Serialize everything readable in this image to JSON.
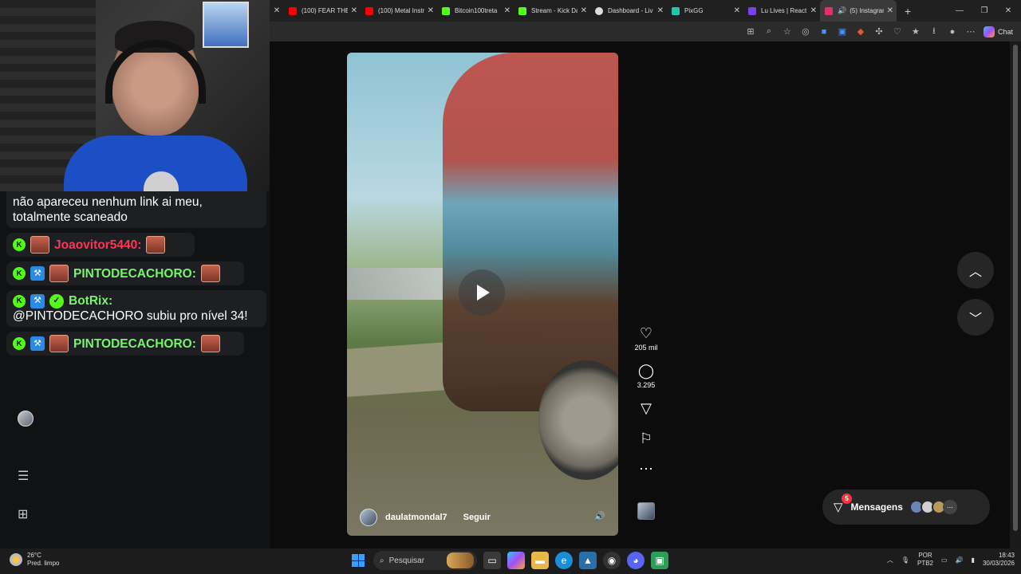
{
  "browser": {
    "tabs": [
      {
        "label": "(100) FEAR THE",
        "color": "#ff0000"
      },
      {
        "label": "(100) Metal Instr",
        "color": "#ff0000"
      },
      {
        "label": "Bitcoin100treta",
        "color": "#53fc18"
      },
      {
        "label": "Stream - Kick Da",
        "color": "#53fc18"
      },
      {
        "label": "Dashboard - Liv",
        "color": "#dddddd"
      },
      {
        "label": "PixGG",
        "color": "#23c4a8"
      },
      {
        "label": "Lu Lives | React",
        "color": "#7a3ff0"
      },
      {
        "label": "(5) Instagram",
        "color": "#e1306c"
      }
    ],
    "chat_button": "Chat"
  },
  "reel": {
    "username": "daulatmondal7",
    "follow_label": "Seguir",
    "likes": "205 mil",
    "comments": "3.295"
  },
  "messages": {
    "label": "Mensagens",
    "badge": "5"
  },
  "stream_chat": {
    "msg1_text": "não apareceu nenhum link ai meu, totalmente scaneado",
    "msg2_user": "Joaovitor5440:",
    "msg3_user": "PINTODECACHORO:",
    "msg4_user": "BotRix:",
    "msg4_text": "@PINTODECACHORO subiu pro nível 34!",
    "msg5_user": "PINTODECACHORO:"
  },
  "taskbar": {
    "weather_temp": "26°C",
    "weather_desc": "Pred. limpo",
    "search_placeholder": "Pesquisar",
    "lang1": "POR",
    "lang2": "PTB2",
    "time": "18:43",
    "date": "30/03/2026"
  }
}
